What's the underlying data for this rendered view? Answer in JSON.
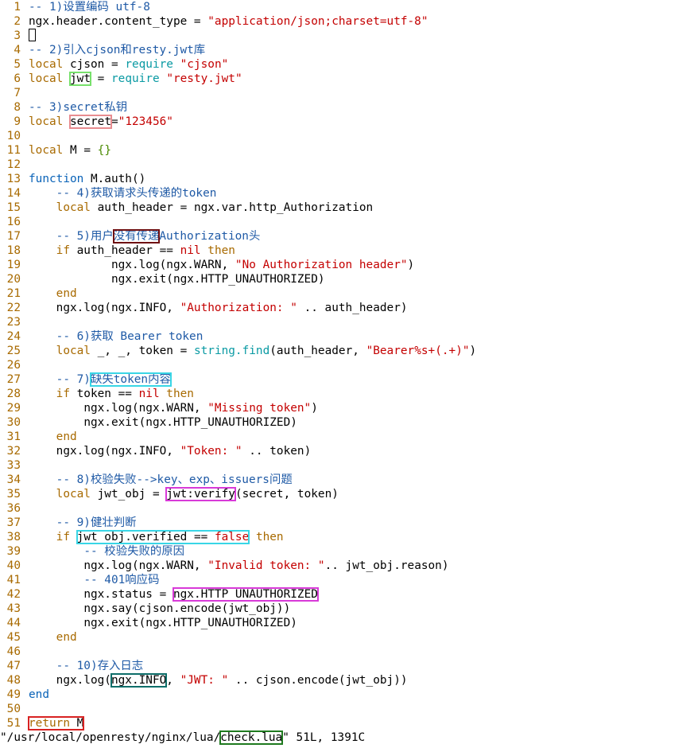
{
  "editor": {
    "line_numbers": [
      "1",
      "2",
      "3",
      "4",
      "5",
      "6",
      "7",
      "8",
      "9",
      "10",
      "11",
      "12",
      "13",
      "14",
      "15",
      "16",
      "17",
      "18",
      "19",
      "20",
      "21",
      "22",
      "23",
      "24",
      "25",
      "26",
      "27",
      "28",
      "29",
      "30",
      "31",
      "32",
      "33",
      "34",
      "35",
      "36",
      "37",
      "38",
      "39",
      "40",
      "41",
      "42",
      "43",
      "44",
      "45",
      "46",
      "47",
      "48",
      "49",
      "50",
      "51"
    ],
    "l1": "-- 1)设置编码 utf-8",
    "l2a": "ngx.header.content_type = ",
    "l2b": "\"application/json;charset=utf-8\"",
    "l4": "-- 2)引入cjson和resty.jwt库",
    "l5a": "local",
    "l5b": " cjson = ",
    "l5c": "require",
    "l5d": " \"cjson\"",
    "l6a": "local",
    "l6b": "jwt",
    "l6c": " = ",
    "l6d": "require",
    "l6e": " \"resty.jwt\"",
    "l8": "-- 3)secret私钥",
    "l9a": "local",
    "l9b": "secret",
    "l9c": "=",
    "l9d": "\"123456\"",
    "l11a": "local",
    "l11b": " M = ",
    "l11c": "{}",
    "l13a": "function",
    "l13b": " M.auth()",
    "l14": "-- 4)获取请求头传递的token",
    "l15a": "local",
    "l15b": " auth_header = ngx.var.http_Authorization",
    "l17a": "-- 5)用户",
    "l17b": "没有传递",
    "l17c": "Authorization头",
    "l18a": "if",
    "l18b": " auth_header == ",
    "l18c": "nil",
    "l18d": "then",
    "l19a": "ngx.log(ngx.WARN, ",
    "l19b": "\"No Authorization header\"",
    "l19c": ")",
    "l20": "ngx.exit(ngx.HTTP_UNAUTHORIZED)",
    "l21": "end",
    "l22a": "ngx.log(ngx.INFO, ",
    "l22b": "\"Authorization: \"",
    "l22c": " .. auth_header)",
    "l24": "-- 6)获取 Bearer token",
    "l25a": "local",
    "l25b": " _, _, token = ",
    "l25c": "string.find",
    "l25d": "(auth_header, ",
    "l25e": "\"Bearer%s+(.+)\"",
    "l25f": ")",
    "l27a": "-- 7)",
    "l27b": "缺失token内容",
    "l28a": "if",
    "l28b": " token == ",
    "l28c": "nil",
    "l28d": "then",
    "l29a": "ngx.log(ngx.WARN, ",
    "l29b": "\"Missing token\"",
    "l29c": ")",
    "l30": "ngx.exit(ngx.HTTP_UNAUTHORIZED)",
    "l31": "end",
    "l32a": "ngx.log(ngx.INFO, ",
    "l32b": "\"Token: \"",
    "l32c": " .. token)",
    "l34": "-- 8)校验失败-->key、exp、issuers问题",
    "l35a": "local",
    "l35b": " jwt_obj = ",
    "l35c": "jwt:verify",
    "l35d": "(secret, token)",
    "l37": "-- 9)健壮判断",
    "l38a": "if",
    "l38b": "jwt_obj.verified == ",
    "l38c": "false",
    "l38d": "then",
    "l39": "-- 校验失败的原因",
    "l40a": "ngx.log(ngx.WARN, ",
    "l40b": "\"Invalid token: \"",
    "l40c": ".. jwt_obj.reason)",
    "l41": "-- 401响应码",
    "l42a": "ngx.status = ",
    "l42b": "ngx.HTTP_UNAUTHORIZED",
    "l43": "ngx.say(cjson.encode(jwt_obj))",
    "l44": "ngx.exit(ngx.HTTP_UNAUTHORIZED)",
    "l45": "end",
    "l47": "-- 10)存入日志",
    "l48a": "ngx.log(",
    "l48b": "ngx.INFO",
    "l48c": ", ",
    "l48d": "\"JWT: \"",
    "l48e": " .. cjson.encode(jwt_obj))",
    "l49": "end",
    "l51a": "return",
    "l51b": " M"
  },
  "statusbar": {
    "path_prefix": "\"/usr/local/openresty/nginx/lua/",
    "filename": "check.lua",
    "suffix": "\" 51L, 1391C"
  },
  "colors": {
    "comment": "#1f5aa6",
    "keyword": "#a86a00",
    "string": "#c40000",
    "builtin": "#0a9aa3",
    "line_number": "#a86a00"
  }
}
